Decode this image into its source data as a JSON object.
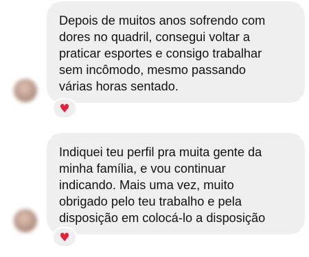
{
  "messages": [
    {
      "text": "Depois de muitos anos sofrendo com\ndores no quadril, consegui voltar a\npraticar esportes e consigo trabalhar\nsem incômodo, mesmo passando\nvárias horas sentado.",
      "reaction_icon": "heart-icon",
      "reaction_glyph": "♥"
    },
    {
      "text": "Indiquei teu perfil pra muita gente da\nminha família, e vou continuar\nindicando. Mais uma vez, muito\nobrigado pelo teu trabalho e pela\ndisposição em colocá-lo a disposição",
      "reaction_icon": "heart-icon",
      "reaction_glyph": "♥"
    }
  ],
  "colors": {
    "bubble_background": "#efefef",
    "text": "#111111",
    "heart": "#e3233c"
  }
}
